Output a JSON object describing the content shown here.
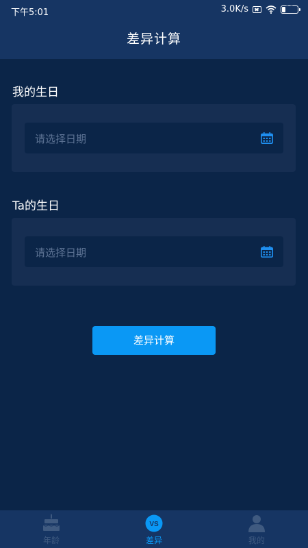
{
  "status_bar": {
    "time": "下午5:01",
    "network_speed": "3.0K/s",
    "battery_level": "23",
    "battery_percent": 23
  },
  "header": {
    "title": "差异计算"
  },
  "form": {
    "my_birthday": {
      "label": "我的生日",
      "placeholder": "请选择日期",
      "icon": "calendar-icon"
    },
    "ta_birthday": {
      "label": "Ta的生日",
      "placeholder": "请选择日期",
      "icon": "calendar-icon"
    },
    "submit_label": "差异计算"
  },
  "tabs": [
    {
      "label": "年龄",
      "icon": "cake-icon",
      "active": false
    },
    {
      "label": "差异",
      "icon": "vs-icon",
      "icon_text": "VS",
      "active": true
    },
    {
      "label": "我的",
      "icon": "user-icon",
      "active": false
    }
  ],
  "colors": {
    "background": "#0b2548",
    "header": "#163563",
    "card": "#162e52",
    "accent": "#0a98f5",
    "inactive_tab": "#3f5a80",
    "placeholder": "#5d7394"
  }
}
